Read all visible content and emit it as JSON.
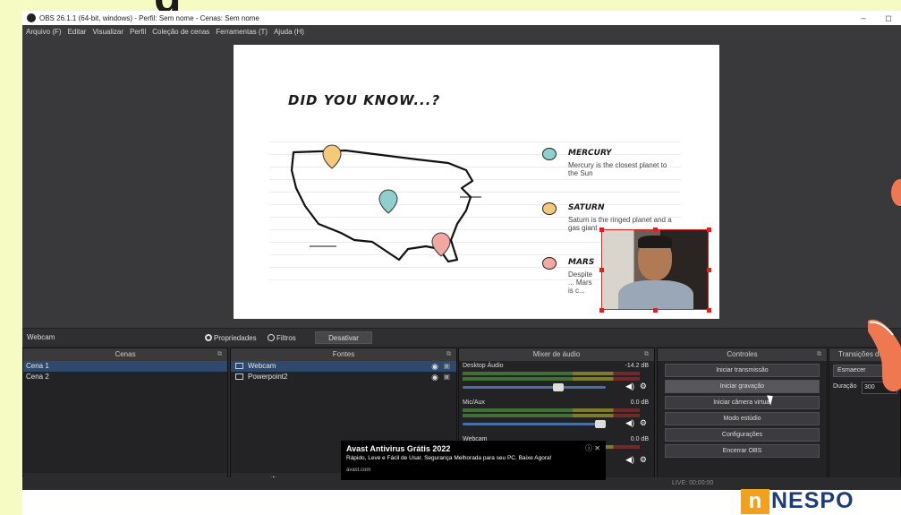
{
  "window": {
    "title": "OBS 26.1.1 (64-bit, windows) - Perfil: Sem nome - Cenas: Sem nome",
    "min_glyph": "–",
    "max_glyph": "◻"
  },
  "overlay": {
    "cut_letter": "g"
  },
  "menu": [
    "Arquivo (F)",
    "Editar",
    "Visualizar",
    "Perfil",
    "Coleção de cenas",
    "Ferramentas (T)",
    "Ajuda (H)"
  ],
  "slide": {
    "title": "DID YOU KNOW...?",
    "items": [
      {
        "name": "MERCURY",
        "desc": "Mercury is the closest planet to the Sun",
        "color": "#8fd0cf"
      },
      {
        "name": "SATURN",
        "desc": "Saturn is the ringed planet and a gas giant",
        "color": "#f5c97a"
      },
      {
        "name": "MARS",
        "desc": "Despite ... Mars is c...",
        "color": "#f2a8a0"
      }
    ]
  },
  "source_bar": {
    "selected": "Webcam",
    "properties": "Propriedades",
    "filters": "Filtros",
    "deactivate": "Desativar"
  },
  "scenes": {
    "title": "Cenas",
    "items": [
      "Cena 1",
      "Cena 2"
    ]
  },
  "sources": {
    "title": "Fontes",
    "items": [
      "Webcam",
      "Powerpoint2"
    ]
  },
  "mixer": {
    "title": "Mixer de áudio",
    "channels": [
      {
        "name": "Desktop Áudio",
        "db": "-14.2 dB",
        "level": 0.68
      },
      {
        "name": "Mic/Aux",
        "db": "0.0 dB",
        "level": 1.0
      },
      {
        "name": "Webcam",
        "db": "0.0 dB",
        "level": 1.0
      }
    ]
  },
  "controls": {
    "title": "Controles",
    "buttons": [
      "Iniciar transmissão",
      "Iniciar gravação",
      "Iniciar câmera virtual",
      "Modo estúdio",
      "Configurações",
      "Encerrar OBS"
    ]
  },
  "transitions": {
    "title": "Transições de",
    "selected": "Esmaecer",
    "duration_label": "Duração",
    "duration_value": "300"
  },
  "status": {
    "live": "LIVE: 00:00:00"
  },
  "ad": {
    "title": "Avast Antivirus Grátis 2022",
    "desc": "Rápido, Leve e Fácil de Usar. Segurança Melhorada para seu PC. Baixe Agora!",
    "url": "avast.com"
  },
  "logo": {
    "letter": "n",
    "rest": "NESPO"
  }
}
